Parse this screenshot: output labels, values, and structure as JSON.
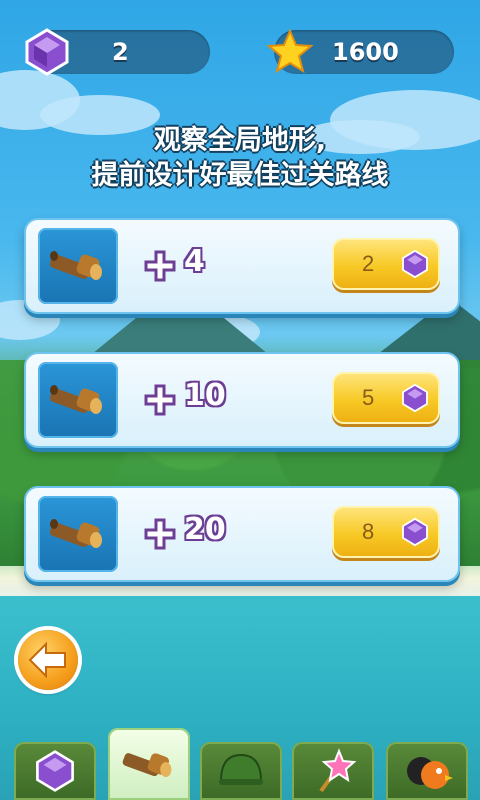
{
  "hud": {
    "gems": "2",
    "coins": "1600",
    "gem_icon": "purple-gem-icon",
    "star_icon": "gold-star-icon"
  },
  "title": {
    "line1": "观察全局地形,",
    "line2": "提前设计好最佳过关路线"
  },
  "offers": [
    {
      "item_icon": "spyglass-icon",
      "amount": "4",
      "cost": "2"
    },
    {
      "item_icon": "spyglass-icon",
      "amount": "10",
      "cost": "5"
    },
    {
      "item_icon": "spyglass-icon",
      "amount": "20",
      "cost": "8"
    }
  ],
  "bottom_tabs": [
    {
      "name": "gems",
      "icon": "purple-gem-icon",
      "active": false
    },
    {
      "name": "spyglass",
      "icon": "spyglass-icon",
      "active": true
    },
    {
      "name": "helmet",
      "icon": "green-helmet-icon",
      "active": false
    },
    {
      "name": "wand",
      "icon": "star-wand-icon",
      "active": false
    },
    {
      "name": "birds",
      "icon": "birds-icon",
      "active": false
    }
  ],
  "colors": {
    "sky": "#49b8ee",
    "card": "#e6f6fd",
    "buy_button": "#f7c925",
    "gem": "#8a4fcf",
    "back_button": "#f59e1b"
  }
}
